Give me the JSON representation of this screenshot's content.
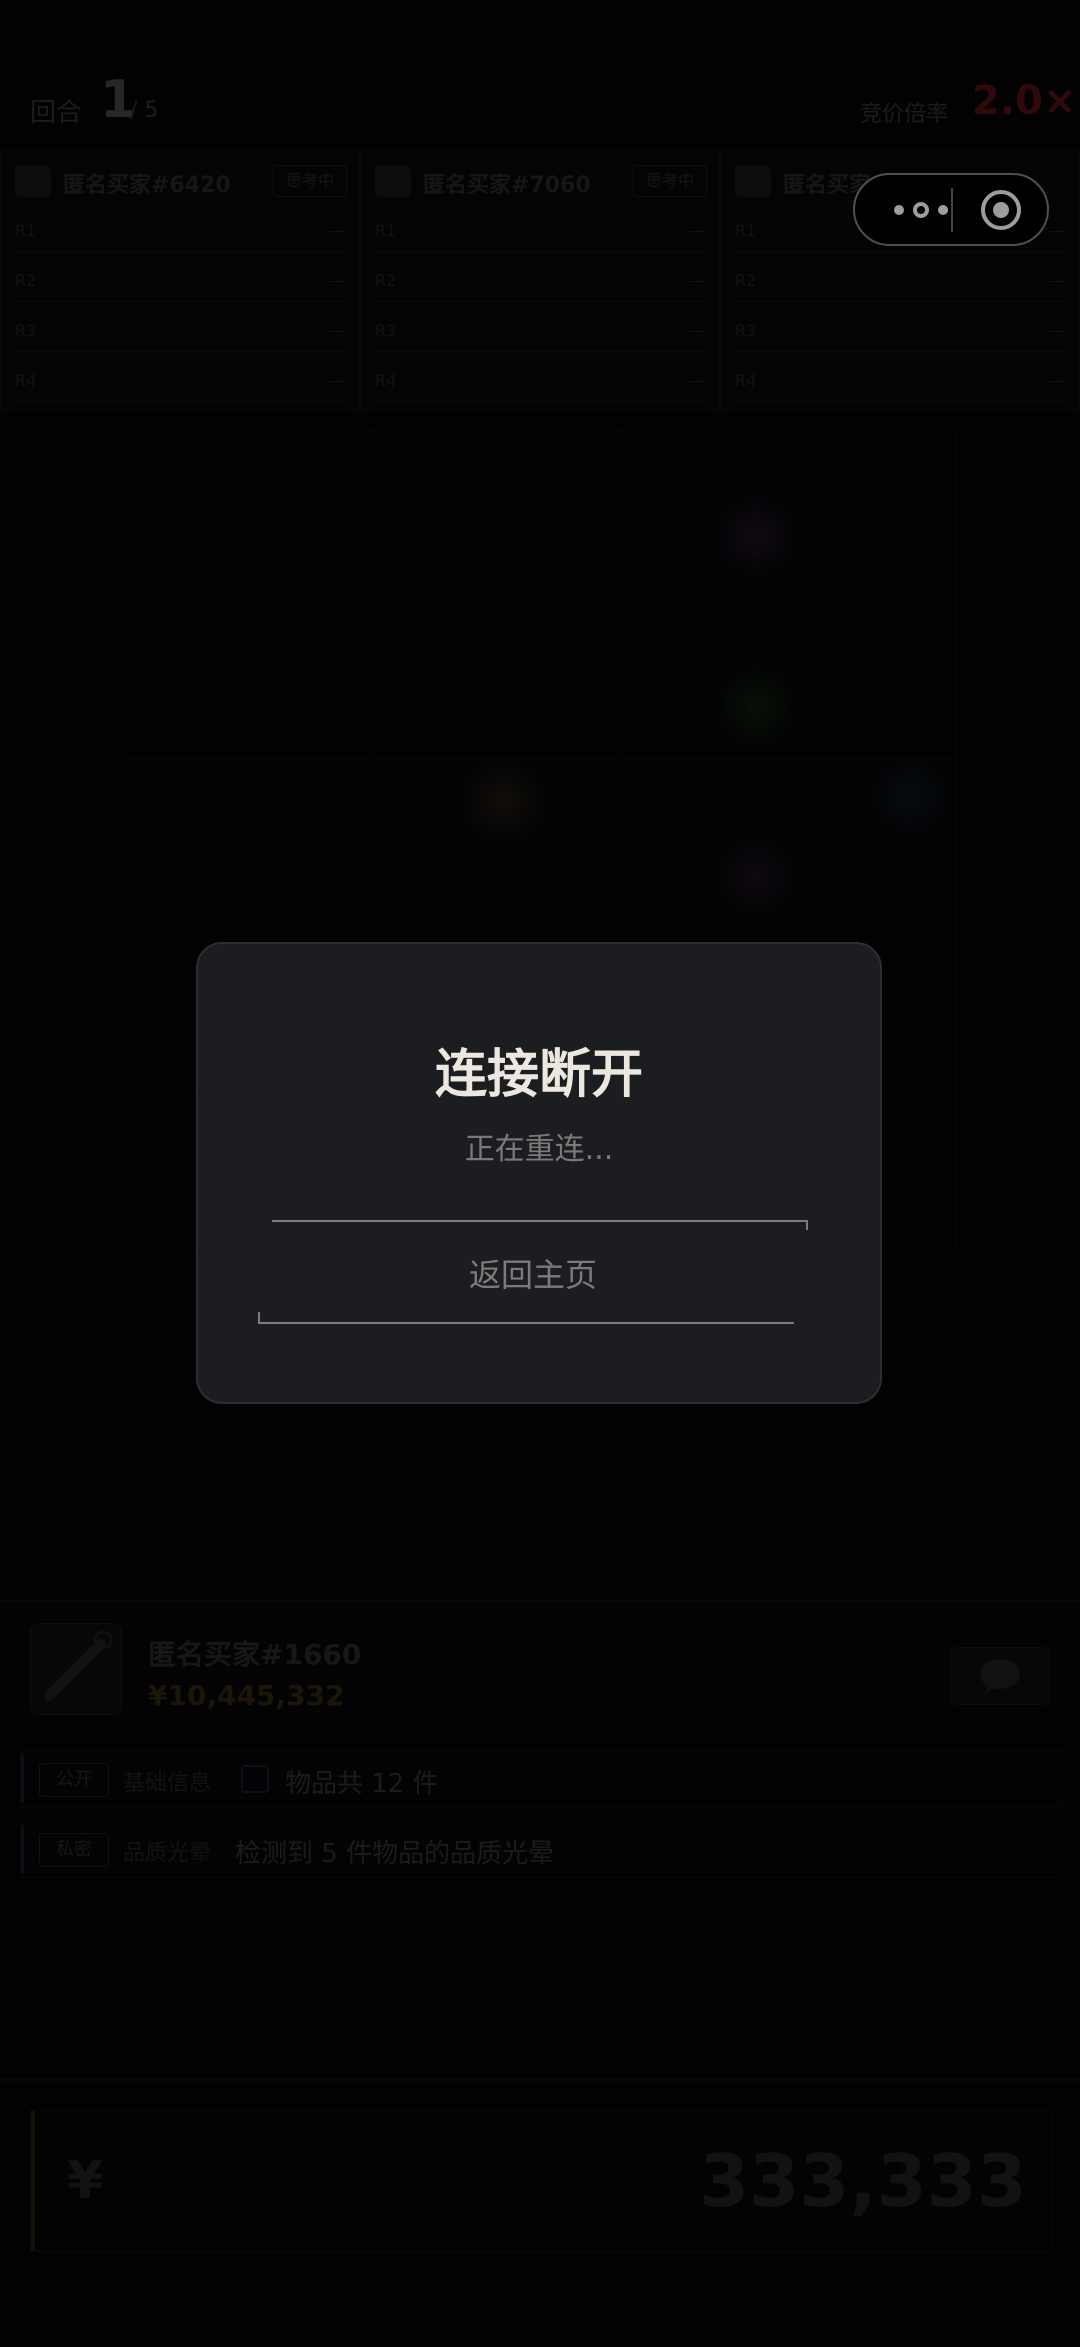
{
  "top": {
    "round_label": "回合",
    "round_current": "1",
    "round_total": "/ 5",
    "multiplier_label": "竞价倍率",
    "multiplier_value": "2.0×"
  },
  "buyers": [
    {
      "name": "匿名买家#6420",
      "status": "思考中",
      "rows": [
        {
          "r": "R1",
          "v": "—"
        },
        {
          "r": "R2",
          "v": "—"
        },
        {
          "r": "R3",
          "v": "—"
        },
        {
          "r": "R4",
          "v": "—"
        }
      ]
    },
    {
      "name": "匿名买家#7060",
      "status": "思考中",
      "rows": [
        {
          "r": "R1",
          "v": "—"
        },
        {
          "r": "R2",
          "v": "—"
        },
        {
          "r": "R3",
          "v": "—"
        },
        {
          "r": "R4",
          "v": "—"
        }
      ]
    },
    {
      "name": "匿名买家#1545",
      "status": "",
      "rows": [
        {
          "r": "R1",
          "v": "—"
        },
        {
          "r": "R2",
          "v": "—"
        },
        {
          "r": "R3",
          "v": "—"
        },
        {
          "r": "R4",
          "v": "—"
        }
      ]
    }
  ],
  "dialog": {
    "title": "连接断开",
    "message": "正在重连...",
    "button": "返回主页"
  },
  "player": {
    "name": "匿名买家#1660",
    "money": "¥10,445,332"
  },
  "info": [
    {
      "tag": "公开",
      "kind": "基础信息",
      "text": "物品共 12 件"
    },
    {
      "tag": "私密",
      "kind": "品质光晕",
      "text": "检测到 5 件物品的品质光晕"
    }
  ],
  "bid": {
    "currency": "¥",
    "amount": "333,333"
  },
  "colors": {
    "dialog_bg": "#1c1d20",
    "title": "#ece8df",
    "multiplier": "#4a0f12"
  }
}
